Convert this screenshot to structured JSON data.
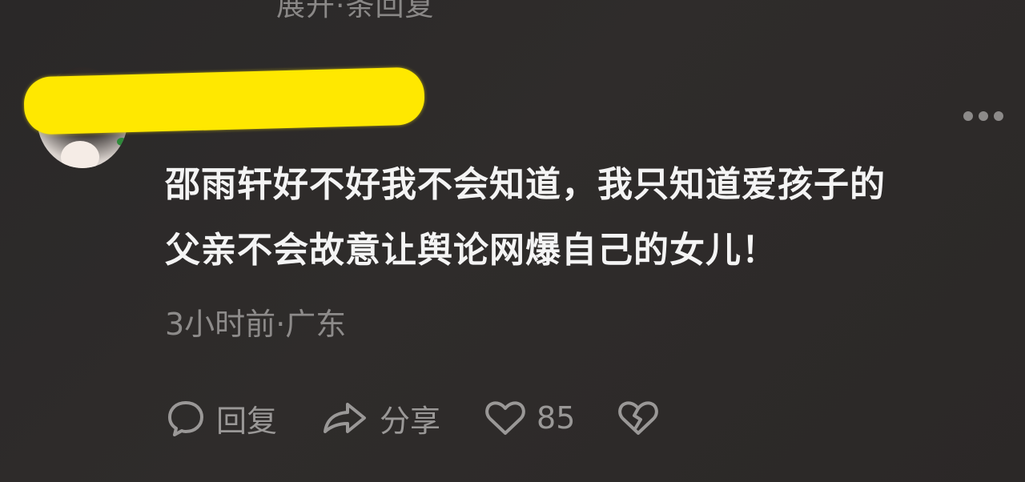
{
  "top_partial_text": "展开·条回复",
  "comment": {
    "username": "",
    "text_line_1": "邵雨轩好不好我不会知道，我只知道爱孩子的",
    "text_line_2": "父亲不会故意让舆论网爆自己的女儿！",
    "time": "3小时前",
    "separator": "·",
    "location": "广东"
  },
  "actions": {
    "reply_label": "回复",
    "share_label": "分享",
    "like_count": "85"
  },
  "icons": {
    "avatar": "avatar-image",
    "more": "more-dots-icon",
    "reply": "comment-bubble-icon",
    "share": "share-arrow-icon",
    "like": "heart-icon",
    "dislike": "broken-heart-icon"
  },
  "colors": {
    "background": "#2b2928",
    "text": "#f2f2f2",
    "muted_text": "#8d8b8a",
    "redaction": "#ffe800"
  }
}
